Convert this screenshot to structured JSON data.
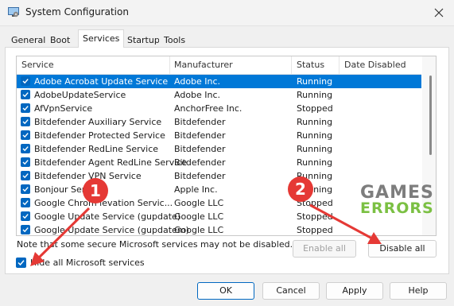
{
  "window": {
    "title": "System Configuration"
  },
  "tabs": [
    "General",
    "Boot",
    "Services",
    "Startup",
    "Tools"
  ],
  "active_tab": "Services",
  "columns": [
    "Service",
    "Manufacturer",
    "Status",
    "Date Disabled"
  ],
  "services": [
    {
      "name": "Adobe Acrobat Update Service",
      "manufacturer": "Adobe Inc.",
      "status": "Running",
      "checked": true
    },
    {
      "name": "AdobeUpdateService",
      "manufacturer": "Adobe Inc.",
      "status": "Running",
      "checked": true
    },
    {
      "name": "AfVpnService",
      "manufacturer": "AnchorFree Inc.",
      "status": "Stopped",
      "checked": true
    },
    {
      "name": "Bitdefender Auxiliary Service",
      "manufacturer": "Bitdefender",
      "status": "Running",
      "checked": true
    },
    {
      "name": "Bitdefender Protected Service",
      "manufacturer": "Bitdefender",
      "status": "Running",
      "checked": true
    },
    {
      "name": "Bitdefender RedLine Service",
      "manufacturer": "Bitdefender",
      "status": "Running",
      "checked": true
    },
    {
      "name": "Bitdefender Agent RedLine Service",
      "manufacturer": "Bitdefender",
      "status": "Running",
      "checked": true
    },
    {
      "name": "Bitdefender VPN Service",
      "manufacturer": "Bitdefender",
      "status": "Running",
      "checked": true
    },
    {
      "name": "Bonjour Serv",
      "manufacturer": "Apple Inc.",
      "status": "Running",
      "checked": true
    },
    {
      "name": "Google Chrom  levation Servic...",
      "manufacturer": "Google LLC",
      "status": "Stopped",
      "checked": true
    },
    {
      "name": "Google Update Service (gupdate)",
      "manufacturer": "Google LLC",
      "status": "Stopped",
      "checked": true
    },
    {
      "name": "Google Update Service (gupdatem)",
      "manufacturer": "Google LLC",
      "status": "Stopped",
      "checked": true
    }
  ],
  "note": "Note that some secure Microsoft services may not be disabled.",
  "buttons": {
    "enable_all": "Enable all",
    "disable_all": "Disable all",
    "ok": "OK",
    "cancel": "Cancel",
    "apply": "Apply",
    "help": "Help"
  },
  "hide_ms": {
    "label": "Hide all Microsoft services",
    "checked": true
  },
  "watermark": {
    "line1": "GAMES",
    "line2": "ERRORS"
  },
  "badges": [
    "1",
    "2"
  ],
  "colors": {
    "accent": "#0067c0",
    "selection": "#0078d7",
    "annotation": "#e53935"
  }
}
